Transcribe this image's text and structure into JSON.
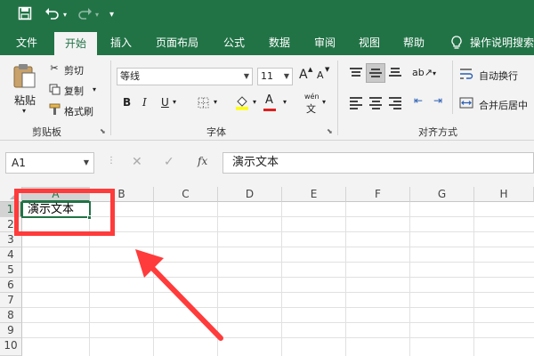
{
  "qat": {
    "save_icon": "save-icon",
    "undo_icon": "undo-icon",
    "redo_icon": "redo-icon",
    "customize_icon": "chevron-down-icon"
  },
  "tabs": [
    "文件",
    "开始",
    "插入",
    "页面布局",
    "公式",
    "数据",
    "审阅",
    "视图",
    "帮助",
    "操作说明搜索"
  ],
  "clipboard": {
    "paste": "粘贴",
    "cut": "剪切",
    "copy": "复制",
    "format_painter": "格式刷",
    "group": "剪贴板"
  },
  "font": {
    "name": "等线",
    "size": "11",
    "bold": "B",
    "italic": "I",
    "underline": "U",
    "wen": "wén",
    "grow": "A",
    "shrink": "A",
    "color_letter": "A",
    "group": "字体"
  },
  "alignment": {
    "wrap": "自动换行",
    "merge": "合并后居中",
    "group": "对齐方式"
  },
  "formula_bar": {
    "name_box": "A1",
    "cancel": "✕",
    "enter": "✓",
    "fx": "fx",
    "content": "演示文本"
  },
  "sheet": {
    "columns": [
      "A",
      "B",
      "C",
      "D",
      "E",
      "F",
      "G",
      "H"
    ],
    "rows": [
      "1",
      "2",
      "3",
      "4",
      "5",
      "6",
      "7",
      "8",
      "9",
      "10"
    ],
    "cell_a1": "演示文本"
  },
  "colors": {
    "excel_green": "#217346",
    "annotation_red": "#ff3b3b"
  }
}
